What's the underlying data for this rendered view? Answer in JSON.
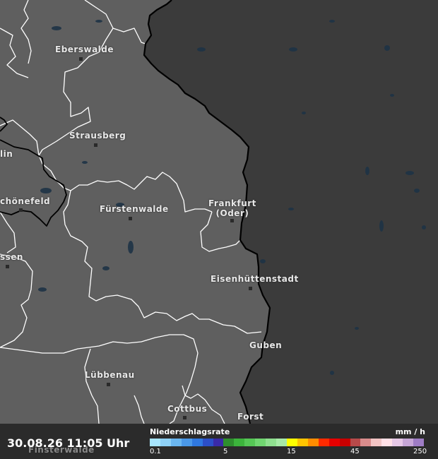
{
  "map": {
    "colors": {
      "land_de": "#5f5f5f",
      "land_pl": "#3b3b3b",
      "water": "#1e3346",
      "district_border": "#ffffff",
      "national_border": "#000000"
    },
    "cities": [
      {
        "name": "Eberswalde"
      },
      {
        "name": "Strausberg"
      },
      {
        "name": "lin"
      },
      {
        "name": "chönefeld"
      },
      {
        "name": "Fürstenwalde"
      },
      {
        "name": "Frankfurt\n(Oder)"
      },
      {
        "name": "ssen"
      },
      {
        "name": "Eisenhüttenstadt"
      },
      {
        "name": "Guben"
      },
      {
        "name": "Lübbenau"
      },
      {
        "name": "Cottbus"
      },
      {
        "name": "Forst"
      },
      {
        "name": "Finsterwalde"
      }
    ]
  },
  "footer": {
    "timestamp": "30.08.26 11:05 Uhr",
    "legend": {
      "title": "Niederschlagsrate",
      "unit": "mm / h",
      "ticks": [
        "0.1",
        "5",
        "15",
        "45",
        "250"
      ],
      "swatches": [
        "#a8e6ff",
        "#8ed1f7",
        "#6ab6f0",
        "#4a98e8",
        "#2f78e0",
        "#2c4fc8",
        "#3a2aa8",
        "#2e8f2e",
        "#3cb43c",
        "#55c755",
        "#70d670",
        "#8fe08f",
        "#a8eaa8",
        "#ffff00",
        "#ffc400",
        "#ff8c00",
        "#ff2a00",
        "#e60000",
        "#c80000",
        "#b84a4a",
        "#d98c8c",
        "#f2c4c4",
        "#ffe0e6",
        "#e6c8e6",
        "#c6a6d6",
        "#9e7cc4"
      ]
    }
  }
}
